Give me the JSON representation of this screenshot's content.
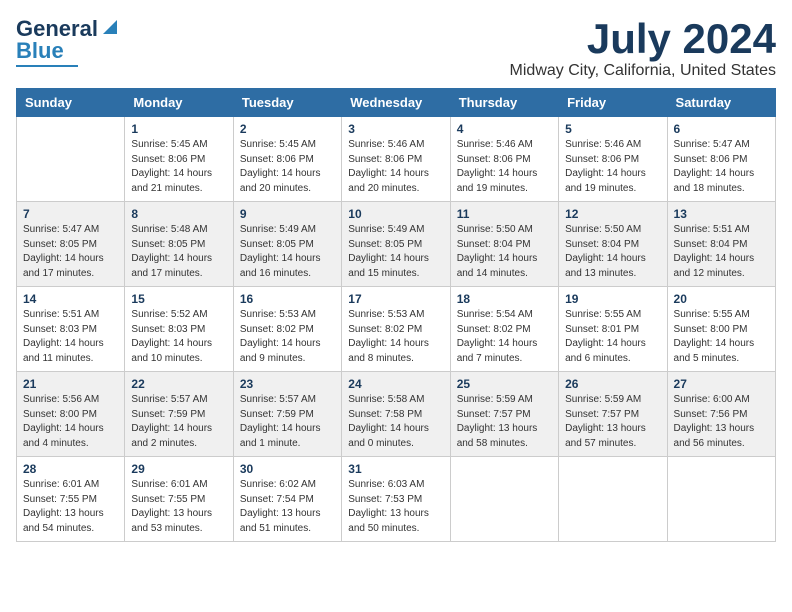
{
  "header": {
    "logo_line1": "General",
    "logo_line2": "Blue",
    "month": "July 2024",
    "location": "Midway City, California, United States"
  },
  "days_of_week": [
    "Sunday",
    "Monday",
    "Tuesday",
    "Wednesday",
    "Thursday",
    "Friday",
    "Saturday"
  ],
  "weeks": [
    [
      {
        "day": "",
        "info": ""
      },
      {
        "day": "1",
        "info": "Sunrise: 5:45 AM\nSunset: 8:06 PM\nDaylight: 14 hours\nand 21 minutes."
      },
      {
        "day": "2",
        "info": "Sunrise: 5:45 AM\nSunset: 8:06 PM\nDaylight: 14 hours\nand 20 minutes."
      },
      {
        "day": "3",
        "info": "Sunrise: 5:46 AM\nSunset: 8:06 PM\nDaylight: 14 hours\nand 20 minutes."
      },
      {
        "day": "4",
        "info": "Sunrise: 5:46 AM\nSunset: 8:06 PM\nDaylight: 14 hours\nand 19 minutes."
      },
      {
        "day": "5",
        "info": "Sunrise: 5:46 AM\nSunset: 8:06 PM\nDaylight: 14 hours\nand 19 minutes."
      },
      {
        "day": "6",
        "info": "Sunrise: 5:47 AM\nSunset: 8:06 PM\nDaylight: 14 hours\nand 18 minutes."
      }
    ],
    [
      {
        "day": "7",
        "info": "Sunrise: 5:47 AM\nSunset: 8:05 PM\nDaylight: 14 hours\nand 17 minutes."
      },
      {
        "day": "8",
        "info": "Sunrise: 5:48 AM\nSunset: 8:05 PM\nDaylight: 14 hours\nand 17 minutes."
      },
      {
        "day": "9",
        "info": "Sunrise: 5:49 AM\nSunset: 8:05 PM\nDaylight: 14 hours\nand 16 minutes."
      },
      {
        "day": "10",
        "info": "Sunrise: 5:49 AM\nSunset: 8:05 PM\nDaylight: 14 hours\nand 15 minutes."
      },
      {
        "day": "11",
        "info": "Sunrise: 5:50 AM\nSunset: 8:04 PM\nDaylight: 14 hours\nand 14 minutes."
      },
      {
        "day": "12",
        "info": "Sunrise: 5:50 AM\nSunset: 8:04 PM\nDaylight: 14 hours\nand 13 minutes."
      },
      {
        "day": "13",
        "info": "Sunrise: 5:51 AM\nSunset: 8:04 PM\nDaylight: 14 hours\nand 12 minutes."
      }
    ],
    [
      {
        "day": "14",
        "info": "Sunrise: 5:51 AM\nSunset: 8:03 PM\nDaylight: 14 hours\nand 11 minutes."
      },
      {
        "day": "15",
        "info": "Sunrise: 5:52 AM\nSunset: 8:03 PM\nDaylight: 14 hours\nand 10 minutes."
      },
      {
        "day": "16",
        "info": "Sunrise: 5:53 AM\nSunset: 8:02 PM\nDaylight: 14 hours\nand 9 minutes."
      },
      {
        "day": "17",
        "info": "Sunrise: 5:53 AM\nSunset: 8:02 PM\nDaylight: 14 hours\nand 8 minutes."
      },
      {
        "day": "18",
        "info": "Sunrise: 5:54 AM\nSunset: 8:02 PM\nDaylight: 14 hours\nand 7 minutes."
      },
      {
        "day": "19",
        "info": "Sunrise: 5:55 AM\nSunset: 8:01 PM\nDaylight: 14 hours\nand 6 minutes."
      },
      {
        "day": "20",
        "info": "Sunrise: 5:55 AM\nSunset: 8:00 PM\nDaylight: 14 hours\nand 5 minutes."
      }
    ],
    [
      {
        "day": "21",
        "info": "Sunrise: 5:56 AM\nSunset: 8:00 PM\nDaylight: 14 hours\nand 4 minutes."
      },
      {
        "day": "22",
        "info": "Sunrise: 5:57 AM\nSunset: 7:59 PM\nDaylight: 14 hours\nand 2 minutes."
      },
      {
        "day": "23",
        "info": "Sunrise: 5:57 AM\nSunset: 7:59 PM\nDaylight: 14 hours\nand 1 minute."
      },
      {
        "day": "24",
        "info": "Sunrise: 5:58 AM\nSunset: 7:58 PM\nDaylight: 14 hours\nand 0 minutes."
      },
      {
        "day": "25",
        "info": "Sunrise: 5:59 AM\nSunset: 7:57 PM\nDaylight: 13 hours\nand 58 minutes."
      },
      {
        "day": "26",
        "info": "Sunrise: 5:59 AM\nSunset: 7:57 PM\nDaylight: 13 hours\nand 57 minutes."
      },
      {
        "day": "27",
        "info": "Sunrise: 6:00 AM\nSunset: 7:56 PM\nDaylight: 13 hours\nand 56 minutes."
      }
    ],
    [
      {
        "day": "28",
        "info": "Sunrise: 6:01 AM\nSunset: 7:55 PM\nDaylight: 13 hours\nand 54 minutes."
      },
      {
        "day": "29",
        "info": "Sunrise: 6:01 AM\nSunset: 7:55 PM\nDaylight: 13 hours\nand 53 minutes."
      },
      {
        "day": "30",
        "info": "Sunrise: 6:02 AM\nSunset: 7:54 PM\nDaylight: 13 hours\nand 51 minutes."
      },
      {
        "day": "31",
        "info": "Sunrise: 6:03 AM\nSunset: 7:53 PM\nDaylight: 13 hours\nand 50 minutes."
      },
      {
        "day": "",
        "info": ""
      },
      {
        "day": "",
        "info": ""
      },
      {
        "day": "",
        "info": ""
      }
    ]
  ]
}
